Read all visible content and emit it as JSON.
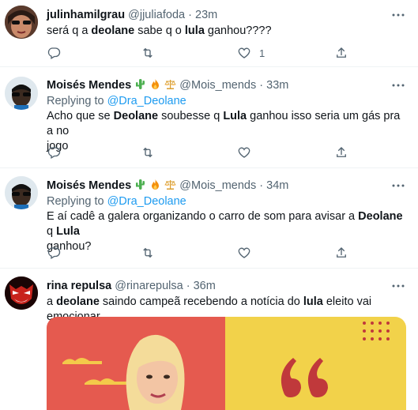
{
  "tweets": [
    {
      "name": "julinhamilgrau",
      "handle": "@jjuliafoda",
      "separator": "·",
      "time": "23m",
      "replying_label": "",
      "replying_to": "",
      "text": [
        {
          "t": "será q a ",
          "b": false
        },
        {
          "t": "deolane",
          "b": true
        },
        {
          "t": " sabe q o ",
          "b": false
        },
        {
          "t": "lula",
          "b": true
        },
        {
          "t": " ganhou????",
          "b": false
        }
      ],
      "likes": "1"
    },
    {
      "name": "Moisés Mendes",
      "emojis": [
        "cactus-emoji",
        "fire-emoji",
        "scales-emoji"
      ],
      "handle": "@Mois_mends",
      "separator": "·",
      "time": "33m",
      "replying_label": "Replying to",
      "replying_to": "@Dra_Deolane",
      "text_line1": [
        {
          "t": "Acho que se ",
          "b": false
        },
        {
          "t": "Deolane",
          "b": true
        },
        {
          "t": " soubesse q ",
          "b": false
        },
        {
          "t": "Lula",
          "b": true
        },
        {
          "t": " ganhou isso seria um gás pra a no",
          "b": false
        }
      ],
      "text_line2": "jogo"
    },
    {
      "name": "Moisés Mendes",
      "emojis": [
        "cactus-emoji",
        "fire-emoji",
        "scales-emoji"
      ],
      "handle": "@Mois_mends",
      "separator": "·",
      "time": "34m",
      "replying_label": "Replying to",
      "replying_to": "@Dra_Deolane",
      "text_line1": [
        {
          "t": "E aí cadê a galera organizando o carro de som para avisar a ",
          "b": false
        },
        {
          "t": "Deolane",
          "b": true
        },
        {
          "t": " q ",
          "b": false
        },
        {
          "t": "Lula",
          "b": true
        }
      ],
      "text_line2": "ganhou?"
    },
    {
      "name": "rina repulsa",
      "handle": "@rinarepulsa",
      "separator": "·",
      "time": "36m",
      "text": [
        {
          "t": "a ",
          "b": false
        },
        {
          "t": "deolane",
          "b": true
        },
        {
          "t": " saindo campeã recebendo a notícia do ",
          "b": false
        },
        {
          "t": "lula",
          "b": true
        },
        {
          "t": " eleito vai emocionar",
          "b": false
        }
      ]
    }
  ],
  "colors": {
    "text": "#0f1419",
    "secondary": "#536471",
    "link": "#1d9bf0",
    "border": "#eff3f4",
    "media_left": "#e55a4f",
    "media_right": "#f2d24a",
    "quote_mark": "#c0393b"
  }
}
